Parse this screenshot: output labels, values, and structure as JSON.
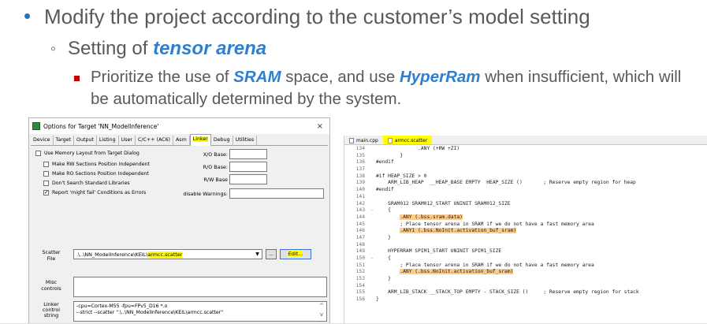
{
  "slide": {
    "bullet1": "Modify the project according to the customer’s model setting",
    "bullet2_prefix": "Setting of ",
    "bullet2_em": "tensor arena",
    "bullet3_a": "Prioritize the use of ",
    "bullet3_em1": "SRAM",
    "bullet3_b": " space, and use ",
    "bullet3_em2": "HyperRam",
    "bullet3_c": " when insufficient, which will be automatically determined by the system."
  },
  "dialog": {
    "title": "Options for Target 'NN_ModelInference'",
    "close": "×",
    "tabs": [
      "Device",
      "Target",
      "Output",
      "Listing",
      "User",
      "C/C++ (AC6)",
      "Asm",
      "Linker",
      "Debug",
      "Utilities"
    ],
    "active_tab": "Linker",
    "checkboxes": [
      {
        "label": "Use Memory Layout from Target Dialog",
        "checked": false
      },
      {
        "label": "Make RW Sections Position Independent",
        "checked": false
      },
      {
        "label": "Make RO Sections Position Independent",
        "checked": false
      },
      {
        "label": "Don't Search Standard Libraries",
        "checked": false
      },
      {
        "label": "Report 'might fail' Conditions as Errors",
        "checked": true
      }
    ],
    "check_mark": "✓",
    "xo_base_label": "X/O Base:",
    "ro_base_label": "R/O Base:",
    "rw_base_label": "R/W Base",
    "disable_warnings_label": "disable Warnings:",
    "scatter_label": "Scatter\nFile",
    "scatter_value_prefix": ".\\..\\NN_ModelInference\\KEIL\\",
    "scatter_value_file": "armcc.scatter",
    "dropdown_arrow": "▼",
    "browse_label": "...",
    "edit_label": "Edit...",
    "misc_label": "Misc\ncontrols",
    "linker_label": "Linker\ncontrol\nstring",
    "linker_string_line1": "-cpu=Cortex-M55 -fpu=FPv5_D16 *.o",
    "linker_string_line2": "--strict --scatter \".\\..\\NN_ModelInference\\KEIL\\armcc.scatter\"",
    "scroll_up": "^",
    "scroll_down": "v"
  },
  "editor": {
    "tabs": [
      {
        "label": "main.cpp",
        "active": false
      },
      {
        "label": "armcc.scatter",
        "active": true
      }
    ],
    "lines": [
      {
        "n": "134",
        "c": "",
        "t": "              .ANY (+RW +ZI)",
        "h": ""
      },
      {
        "n": "135",
        "c": "",
        "t": "        }",
        "h": ""
      },
      {
        "n": "136",
        "c": "",
        "t": "#endif",
        "h": "",
        "pp": true
      },
      {
        "n": "137",
        "c": "",
        "t": "",
        "h": ""
      },
      {
        "n": "138",
        "c": "",
        "t": "#if HEAP_SIZE > 0",
        "h": "",
        "pp": true
      },
      {
        "n": "139",
        "c": "",
        "t": "    ARM_LIB_HEAP  __HEAP_BASE EMPTY  HEAP_SIZE ()       ; Reserve empty region for heap",
        "h": ""
      },
      {
        "n": "140",
        "c": "",
        "t": "#endif",
        "h": "",
        "pp": true
      },
      {
        "n": "141",
        "c": "",
        "t": "",
        "h": ""
      },
      {
        "n": "142",
        "c": "",
        "t": "    SRAM012 SRAM012_START UNINIT SRAM012_SIZE",
        "h": ""
      },
      {
        "n": "143",
        "c": "-",
        "t": "    {",
        "h": ""
      },
      {
        "n": "144",
        "c": "",
        "t": "        ",
        "h": ".ANY (.bss.sram.data)"
      },
      {
        "n": "145",
        "c": "",
        "t": "        ; Place tensor arena in SRAM if we do not have a fast memory area",
        "h": "",
        "cm": true
      },
      {
        "n": "146",
        "c": "",
        "t": "        ",
        "h": ".ANY1 (.bss.NoInit.activation_buf_sram)"
      },
      {
        "n": "147",
        "c": "",
        "t": "    }",
        "h": ""
      },
      {
        "n": "148",
        "c": "",
        "t": "",
        "h": ""
      },
      {
        "n": "149",
        "c": "",
        "t": "    HYPERRAM SPIM1_START UNINIT SPIM1_SIZE",
        "h": ""
      },
      {
        "n": "150",
        "c": "-",
        "t": "    {",
        "h": ""
      },
      {
        "n": "151",
        "c": "",
        "t": "        ; Place tensor arena in SRAM if we do not have a fast memory area",
        "h": "",
        "cm": true
      },
      {
        "n": "152",
        "c": "",
        "t": "        ",
        "h": ".ANY (.bss.NoInit.activation_buf_sram)"
      },
      {
        "n": "153",
        "c": "",
        "t": "    }",
        "h": ""
      },
      {
        "n": "154",
        "c": "",
        "t": "",
        "h": ""
      },
      {
        "n": "155",
        "c": "",
        "t": "    ARM_LIB_STACK __STACK_TOP EMPTY - STACK_SIZE ()     ; Reserve empty region for stack",
        "h": ""
      },
      {
        "n": "156",
        "c": "",
        "t": "}",
        "h": ""
      }
    ]
  }
}
